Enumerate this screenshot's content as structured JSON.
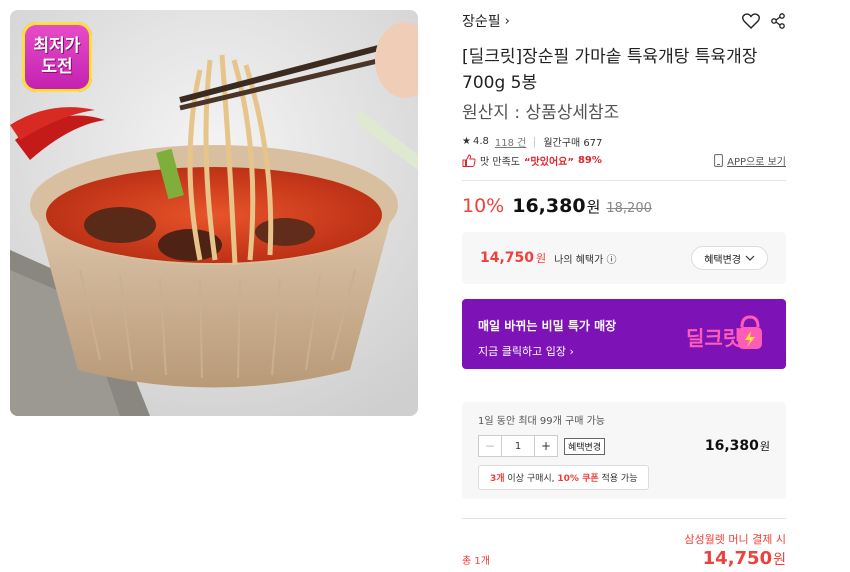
{
  "badge": {
    "line1": "최저가",
    "line2": "도전"
  },
  "brand": {
    "name": "장순필",
    "chevron": "›"
  },
  "icons": {
    "heart": "heart-icon",
    "share": "share-icon"
  },
  "product": {
    "title": "[딜크릿]장순필 가마솥 특육개탕 특육개장 700g 5봉",
    "origin": "원산지 : 상품상세참조"
  },
  "meta": {
    "rating": "4.8",
    "review_count": "118 건",
    "monthly_sales": "월간구매 677"
  },
  "satisfaction": {
    "label": "맛 만족도",
    "quote": "“맛있어요”",
    "percent": "89%",
    "app_link": "APP으로 보기"
  },
  "price": {
    "discount": "10%",
    "sale": "16,380",
    "currency": "원",
    "original": "18,200"
  },
  "benefit": {
    "price": "14,750",
    "currency": "원",
    "label": "나의 혜택가 ⓘ",
    "button": "혜택변경"
  },
  "deal": {
    "line1": "매일 바뀌는 비밀 특가 매장",
    "line2": "지금 클릭하고 입장 ›",
    "logo_text": "딜크릿"
  },
  "quantity": {
    "limit": "1일 동안 최대 99개 구매 가능",
    "minus": "−",
    "value": "1",
    "plus": "+",
    "change": "혜택변경",
    "row_price": "16,380",
    "currency": "원",
    "coupon_red1": "3개",
    "coupon_mid": " 이상 구매시, ",
    "coupon_red2": "10% 쿠폰",
    "coupon_end": " 적용 가능"
  },
  "total": {
    "pay_note": "삼성월렛 머니 결제 시",
    "label": "총 1개",
    "price": "14,750",
    "currency": "원"
  },
  "colors": {
    "accent_red": "#f0403c",
    "deal_purple": "#7d12b7",
    "badge_pink": "#d62fbf"
  }
}
